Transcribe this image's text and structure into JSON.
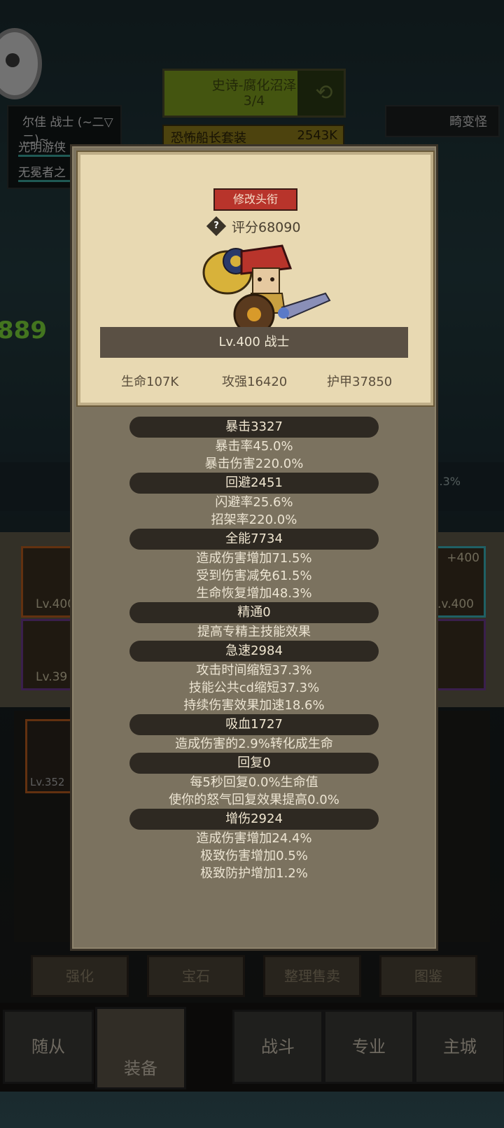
{
  "background": {
    "stage_name": "史诗-腐化沼泽",
    "stage_progress": "3/4",
    "set_name": "恐怖船长套装",
    "set_value": "2543K",
    "enemy_name": "畸变怪",
    "party_header": "尔佳 战士 (~二▽二)~",
    "party_member_1": "光明游侠",
    "party_member_2": "无冕者之",
    "damage_number": "889",
    "percent_text": "1.3%",
    "slot_level_1": "Lv.400",
    "slot_level_2": "Lv.39",
    "slot_level_3": ".v.400",
    "slot_plus": "+4",
    "slot_plus_right": "+400",
    "bag_level": "Lv.352",
    "actions": [
      "强化",
      "宝石",
      "整理售卖",
      "图鉴"
    ],
    "nav": [
      "随从",
      "装备",
      "战斗",
      "专业",
      "主城"
    ]
  },
  "card": {
    "retitle_button": "修改头衔",
    "score": "评分68090",
    "level_class": "Lv.400 战士",
    "hp": "生命107K",
    "attack": "攻强16420",
    "armor": "护甲37850"
  },
  "stats": [
    {
      "header": "暴击3327",
      "lines": [
        "暴击率45.0%",
        "暴击伤害220.0%"
      ]
    },
    {
      "header": "回避2451",
      "lines": [
        "闪避率25.6%",
        "招架率220.0%"
      ]
    },
    {
      "header": "全能7734",
      "lines": [
        "造成伤害增加71.5%",
        "受到伤害减免61.5%",
        "生命恢复增加48.3%"
      ]
    },
    {
      "header": "精通0",
      "lines": [
        "提高专精主技能效果"
      ]
    },
    {
      "header": "急速2984",
      "lines": [
        "攻击时间缩短37.3%",
        "技能公共cd缩短37.3%",
        "持续伤害效果加速18.6%"
      ]
    },
    {
      "header": "吸血1727",
      "lines": [
        "造成伤害的2.9%转化成生命"
      ]
    },
    {
      "header": "回复0",
      "lines": [
        "每5秒回复0.0%生命值",
        "使你的怒气回复效果提高0.0%"
      ]
    },
    {
      "header": "增伤2924",
      "lines": [
        "造成伤害增加24.4%",
        "极致伤害增加0.5%",
        "极致防护增加1.2%"
      ]
    }
  ]
}
